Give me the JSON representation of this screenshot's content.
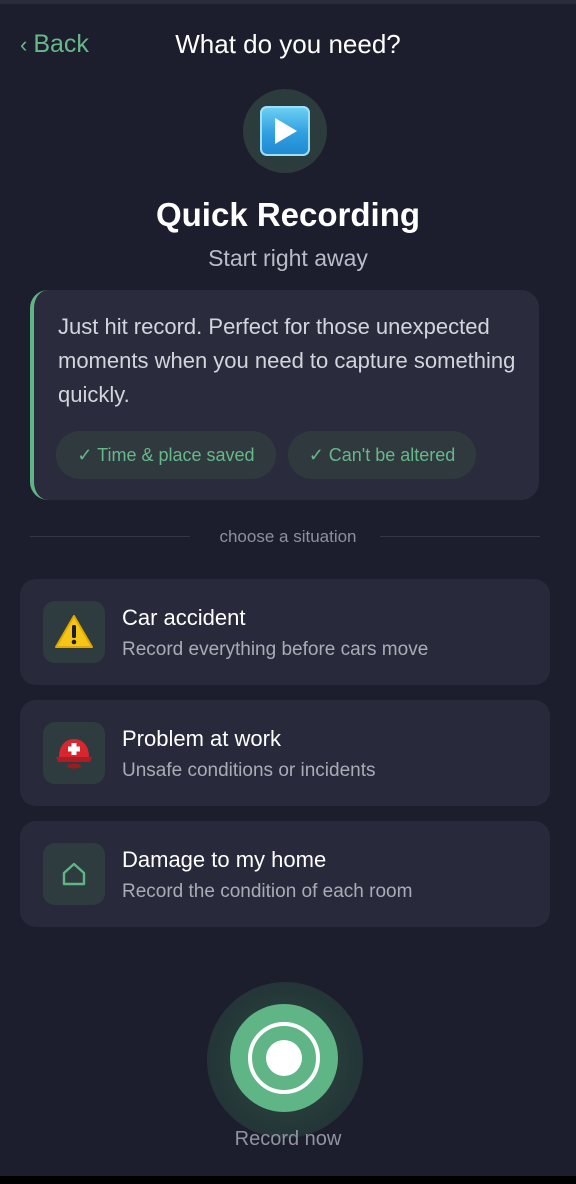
{
  "header": {
    "back_label": "Back",
    "title": "What do you need?"
  },
  "hero": {
    "icon": "play-button-icon",
    "title": "Quick Recording",
    "subtitle": "Start right away"
  },
  "description": {
    "text": "Just hit record. Perfect for those unexpected moments when you need to capture something quickly.",
    "chips": [
      {
        "label": "✓ Time & place saved"
      },
      {
        "label": "✓ Can't be altered"
      }
    ]
  },
  "divider": {
    "label": "choose a situation"
  },
  "situations": [
    {
      "icon": "warning-icon",
      "title": "Car accident",
      "subtitle": "Record everything before cars move"
    },
    {
      "icon": "rescue-helmet-icon",
      "title": "Problem at work",
      "subtitle": "Unsafe conditions or incidents"
    },
    {
      "icon": "home-icon",
      "title": "Damage to my home",
      "subtitle": "Record the condition of each room"
    }
  ],
  "record": {
    "label": "Record now"
  },
  "colors": {
    "background": "#1c1e2d",
    "card": "#282a3b",
    "accent": "#5fb585",
    "accent_text": "#66b889"
  }
}
